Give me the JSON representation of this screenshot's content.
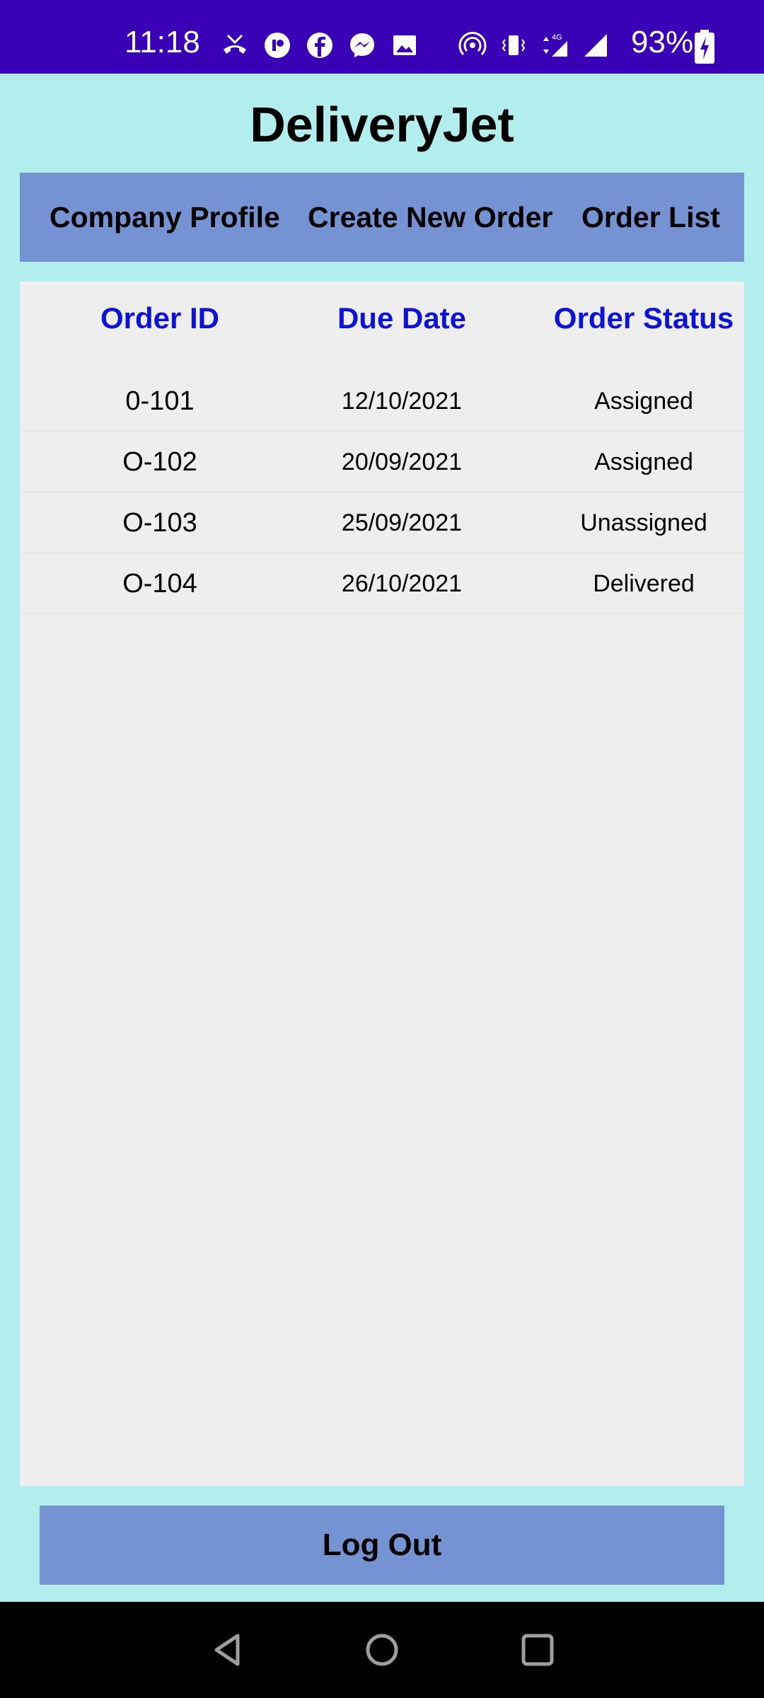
{
  "status_bar": {
    "time": "11:18",
    "battery": "93%",
    "network": "4G",
    "icons_left": [
      "missed-call-icon",
      "app-icon",
      "facebook-icon",
      "messenger-icon",
      "gallery-icon"
    ],
    "icons_right": [
      "hotspot-icon",
      "vibrate-icon",
      "data-arrows-icon",
      "signal-icon",
      "signal-icon",
      "battery-charging-icon"
    ],
    "bg_color": "#3a00b5"
  },
  "app": {
    "title": "DeliveryJet",
    "bg_color": "#b2eeee",
    "accent_color": "#7592d2"
  },
  "nav": {
    "items": [
      {
        "label": "Company Profile"
      },
      {
        "label": "Create New Order"
      },
      {
        "label": "Order List"
      }
    ]
  },
  "table": {
    "headers": [
      "Order ID",
      "Due Date",
      "Order Status"
    ],
    "header_color": "#0c12d8",
    "rows": [
      {
        "id": "0-101",
        "due": "12/10/2021",
        "status": "Assigned"
      },
      {
        "id": "O-102",
        "due": "20/09/2021",
        "status": "Assigned"
      },
      {
        "id": "O-103",
        "due": "25/09/2021",
        "status": "Unassigned"
      },
      {
        "id": "O-104",
        "due": "26/10/2021",
        "status": "Delivered"
      }
    ]
  },
  "logout": {
    "label": "Log Out"
  },
  "system_nav": {
    "buttons": [
      "back-icon",
      "home-icon",
      "recents-icon"
    ]
  }
}
